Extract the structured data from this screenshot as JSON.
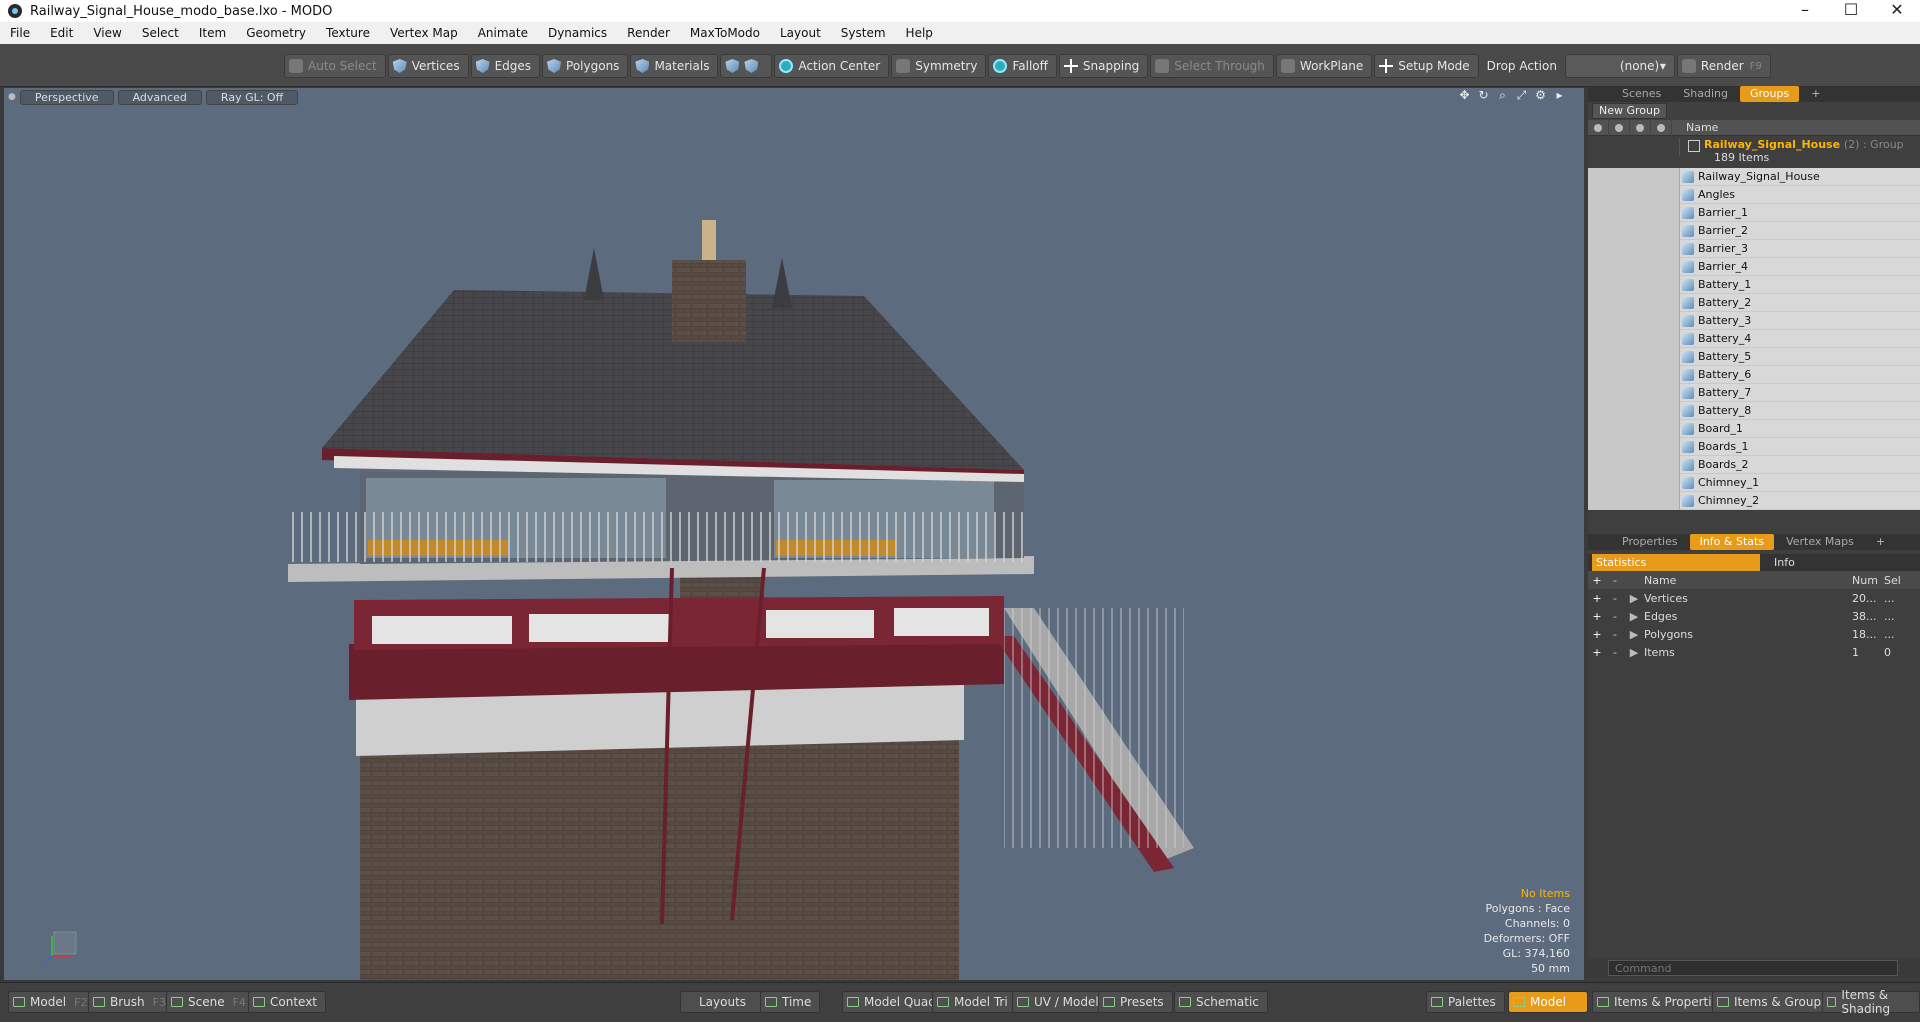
{
  "window": {
    "title": "Railway_Signal_House_modo_base.lxo - MODO",
    "min": "–",
    "max": "☐",
    "close": "✕"
  },
  "menu": [
    "File",
    "Edit",
    "View",
    "Select",
    "Item",
    "Geometry",
    "Texture",
    "Vertex Map",
    "Animate",
    "Dynamics",
    "Render",
    "MaxToModo",
    "Layout",
    "System",
    "Help"
  ],
  "toolbar": {
    "auto_select": "Auto Select",
    "vertices": "Vertices",
    "edges": "Edges",
    "polygons": "Polygons",
    "materials": "Materials",
    "action_center": "Action Center",
    "symmetry": "Symmetry",
    "falloff": "Falloff",
    "snapping": "Snapping",
    "select_through": "Select Through",
    "workplane": "WorkPlane",
    "setup_mode": "Setup Mode",
    "drop_action": "Drop Action",
    "drop_value": "(none)",
    "render": "Render",
    "render_key": "F9"
  },
  "viewport": {
    "tabs": [
      "Perspective",
      "Advanced",
      "Ray GL: Off"
    ],
    "info": {
      "no_items": "No Items",
      "polygons": "Polygons : Face",
      "channels": "Channels: 0",
      "deformers": "Deformers: OFF",
      "gl": "GL: 374,160",
      "lens": "50 mm"
    }
  },
  "scene_panel": {
    "tabs": [
      "Scenes",
      "Shading",
      "Groups"
    ],
    "active_tab": "Groups",
    "plus": "+",
    "new_group": "New Group",
    "col_name": "Name",
    "group": {
      "name": "Railway_Signal_House",
      "suffix": "(2) : Group",
      "count": "189 Items"
    },
    "items": [
      "Railway_Signal_House",
      "Angles",
      "Barrier_1",
      "Barrier_2",
      "Barrier_3",
      "Barrier_4",
      "Battery_1",
      "Battery_2",
      "Battery_3",
      "Battery_4",
      "Battery_5",
      "Battery_6",
      "Battery_7",
      "Battery_8",
      "Board_1",
      "Boards_1",
      "Boards_2",
      "Chimney_1",
      "Chimney_2"
    ]
  },
  "props_panel": {
    "tabs": [
      "Properties",
      "Info & Stats",
      "Vertex Maps"
    ],
    "active_tab": "Info & Stats",
    "plus": "+",
    "stats_tab": "Statistics",
    "info_tab": "Info",
    "headers": {
      "name": "Name",
      "num": "Num",
      "sel": "Sel"
    },
    "rows": [
      {
        "name": "Vertices",
        "num": "20...",
        "sel": "..."
      },
      {
        "name": "Edges",
        "num": "38...",
        "sel": "..."
      },
      {
        "name": "Polygons",
        "num": "18...",
        "sel": "..."
      },
      {
        "name": "Items",
        "num": "1",
        "sel": "0"
      }
    ]
  },
  "command": {
    "placeholder": "Command"
  },
  "bottom": {
    "model": "Model",
    "model_key": "F2",
    "brush": "Brush",
    "brush_key": "F3",
    "scene": "Scene",
    "scene_key": "F4",
    "context": "Context",
    "layouts": "Layouts",
    "time": "Time",
    "model_quad": "Model Quad",
    "model_tri": "Model Tri",
    "uv_model": "UV / Model",
    "presets": "Presets",
    "schematic": "Schematic",
    "palettes": "Palettes",
    "model_active": "Model",
    "items_props": "Items & Properties",
    "items_groups": "Items & Groups",
    "items_shading": "Items & Shading"
  }
}
